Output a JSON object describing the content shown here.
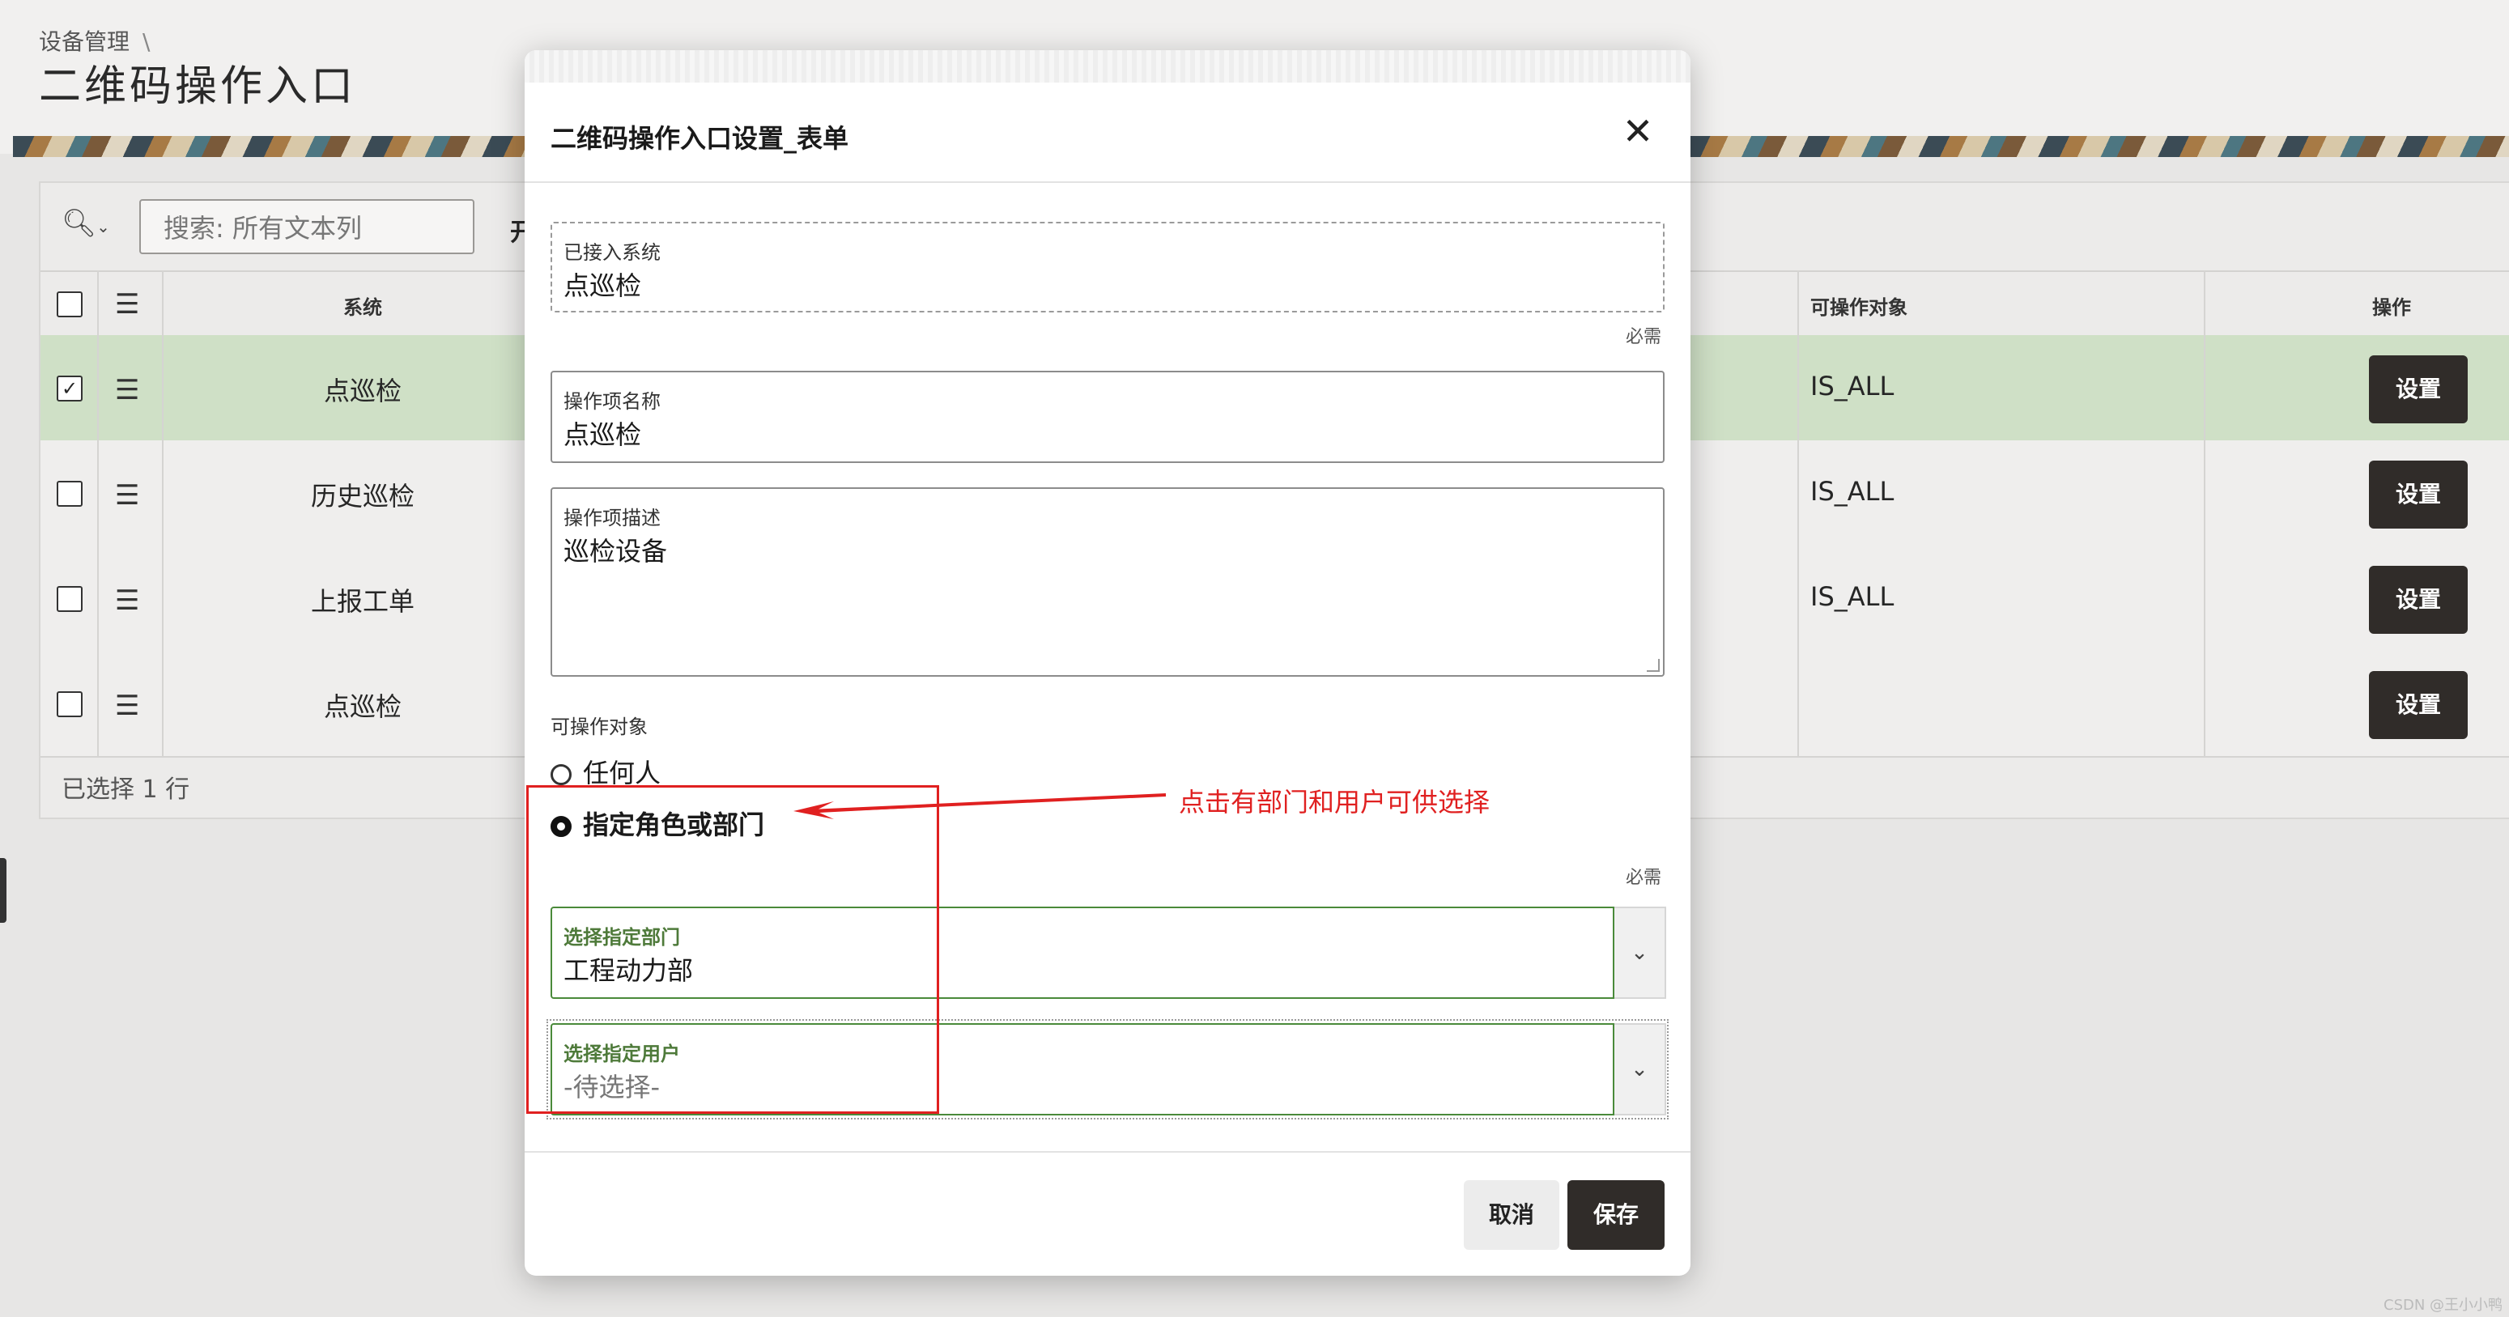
{
  "header": {
    "breadcrumb": "设备管理",
    "breadcrumb_sep": "\\",
    "title": "二维码操作入口"
  },
  "toolbar": {
    "search_icon": "search-icon",
    "search_placeholder": "搜索: 所有文本列",
    "partial_label": "开"
  },
  "grid": {
    "columns": {
      "system": "系统",
      "operable_object": "可操作对象",
      "action": "操作"
    },
    "rows": [
      {
        "system": "点巡检",
        "operable_object": "IS_ALL",
        "action": "设置",
        "selected": true
      },
      {
        "system": "历史巡检",
        "operable_object": "IS_ALL",
        "action": "设置",
        "selected": false
      },
      {
        "system": "上报工单",
        "operable_object": "IS_ALL",
        "action": "设置",
        "selected": false
      },
      {
        "system": "点巡检",
        "operable_object": "",
        "action": "设置",
        "selected": false
      }
    ],
    "footer": "已选择 1 行"
  },
  "modal": {
    "title": "二维码操作入口设置_表单",
    "close_icon": "close-icon",
    "fields": {
      "system": {
        "label": "已接入系统",
        "value": "点巡检",
        "required": "必需"
      },
      "item_name": {
        "label": "操作项名称",
        "value": "点巡检"
      },
      "item_desc": {
        "label": "操作项描述",
        "value": "巡检设备"
      }
    },
    "operable_object": {
      "label": "可操作对象",
      "options": [
        "任何人",
        "指定角色或部门"
      ],
      "selected": "指定角色或部门",
      "required": "必需"
    },
    "dept_select": {
      "label": "选择指定部门",
      "value": "工程动力部"
    },
    "user_select": {
      "label": "选择指定用户",
      "placeholder": "-待选择-"
    },
    "buttons": {
      "cancel": "取消",
      "save": "保存"
    }
  },
  "annotation": {
    "text": "点击有部门和用户可供选择",
    "color": "#e02020"
  },
  "watermark": "CSDN @王小小鸭"
}
